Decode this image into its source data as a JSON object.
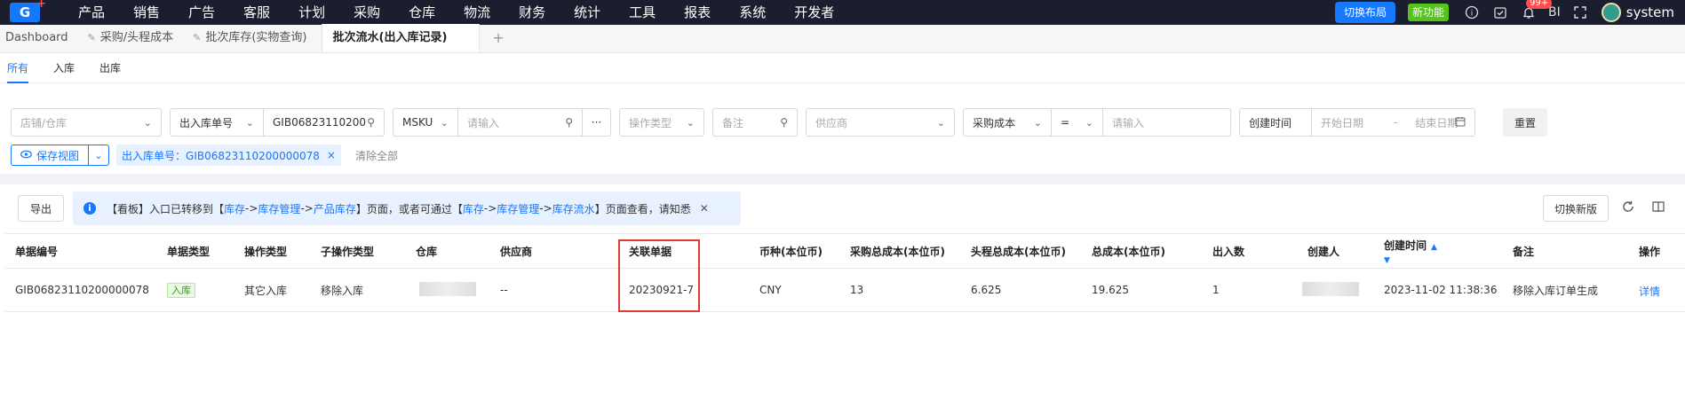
{
  "nav": {
    "logo": "G",
    "menu": [
      "产品",
      "销售",
      "广告",
      "客服",
      "计划",
      "采购",
      "仓库",
      "物流",
      "财务",
      "统计",
      "工具",
      "报表",
      "系统",
      "开发者"
    ],
    "switch_layout": "切换布局",
    "new_feature": "新功能",
    "badge": "99+",
    "bi": "BI",
    "username": "system"
  },
  "pagetabs": [
    "Dashboard",
    "采购/头程成本",
    "批次库存(实物查询)",
    "批次流水(出入库记录)"
  ],
  "add_tab": "+",
  "subtabs": [
    "所有",
    "入库",
    "出库"
  ],
  "filters": {
    "shop_placeholder": "店铺/仓库",
    "doc_type": "出入库单号",
    "doc_value": "GIB06823110200",
    "msku": "MSKU",
    "msku_placeholder": "请输入",
    "more": "···",
    "op_type_placeholder": "操作类型",
    "remark_placeholder": "备注",
    "supplier_placeholder": "供应商",
    "cost_type": "采购成本",
    "op": "=",
    "cost_placeholder": "请输入",
    "created_label": "创建时间",
    "start_placeholder": "开始日期",
    "dash": "-",
    "end_placeholder": "结束日期",
    "reset": "重置"
  },
  "row2": {
    "save_view": "保存视图",
    "filter_tag": "出入库单号：GIB06823110200000078",
    "clear_all": "清除全部"
  },
  "toolbar": {
    "export": "导出",
    "notice_pre": "【看板】入口已转移到【",
    "notice_l1": "库存",
    "arrow1": " -> ",
    "notice_l2": "库存管理",
    "arrow2": " -> ",
    "notice_l3": "产品库存",
    "notice_mid": "】页面，或者可通过【",
    "notice_l4": "库存",
    "arrow3": " -> ",
    "notice_l5": "库存管理",
    "arrow4": " -> ",
    "notice_l6": "库存流水",
    "notice_end": "】页面查看，请知悉",
    "switch_new": "切换新版"
  },
  "table": {
    "headers": [
      "单据编号",
      "单据类型",
      "操作类型",
      "子操作类型",
      "仓库",
      "供应商",
      "关联单据",
      "币种(本位币)",
      "采购总成本(本位币)",
      "头程总成本(本位币)",
      "总成本(本位币)",
      "出入数",
      "创建人",
      "创建时间",
      "备注",
      "操作"
    ],
    "row": {
      "doc_no": "GIB06823110200000078",
      "doc_type": "入库",
      "op_type": "其它入库",
      "sub_op": "移除入库",
      "supplier": "--",
      "related": "20230921-7",
      "currency": "CNY",
      "purchase_cost": "13",
      "freight_cost": "6.625",
      "total_cost": "19.625",
      "qty": "1",
      "created_at": "2023-11-02 11:38:36",
      "remark": "移除入库订单生成",
      "action": "详情"
    }
  }
}
